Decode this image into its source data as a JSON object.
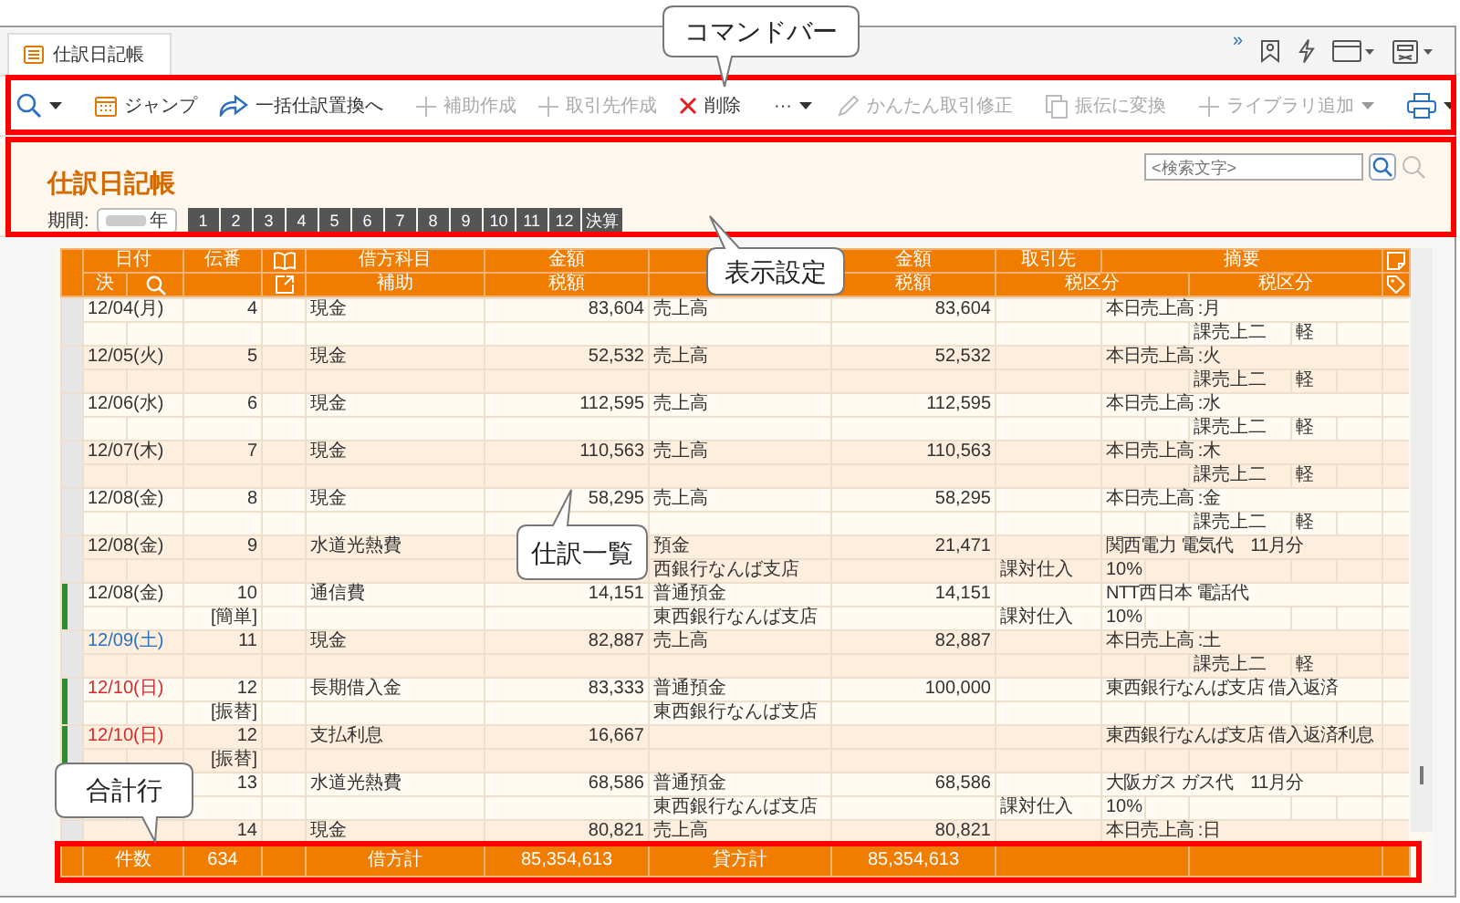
{
  "tab": {
    "title": "仕訳日記帳"
  },
  "window_bar": {
    "overflow": "»"
  },
  "toolbar": {
    "buttons": [
      {
        "label": "ジャンプ",
        "disabled": false
      },
      {
        "label": "一括仕訳置換へ",
        "disabled": false
      },
      {
        "label": "補助作成",
        "disabled": true
      },
      {
        "label": "取引先作成",
        "disabled": true
      },
      {
        "label": "削除",
        "disabled": false
      }
    ],
    "more": "···",
    "right_buttons": [
      {
        "label": "かんたん取引修正",
        "disabled": true
      },
      {
        "label": "振伝に変換",
        "disabled": true
      },
      {
        "label": "ライブラリ追加",
        "disabled": true
      }
    ]
  },
  "settings": {
    "title": "仕訳日記帳",
    "search_placeholder": "<検索文字>",
    "period_label": "期間:",
    "year_suffix": "年",
    "months": [
      {
        "label": "1",
        "selected": false
      },
      {
        "label": "2",
        "selected": false
      },
      {
        "label": "3",
        "selected": false
      },
      {
        "label": "4",
        "selected": false
      },
      {
        "label": "5",
        "selected": false
      },
      {
        "label": "6",
        "selected": false
      },
      {
        "label": "7",
        "selected": false
      },
      {
        "label": "8",
        "selected": false
      },
      {
        "label": "9",
        "selected": false
      },
      {
        "label": "10",
        "selected": false
      },
      {
        "label": "11",
        "selected": false
      },
      {
        "label": "12",
        "selected": false
      },
      {
        "label": "決算",
        "selected": false
      }
    ]
  },
  "table": {
    "header_top": [
      "日付",
      "伝番",
      "借方科目",
      "金額",
      "金額",
      "取引先",
      "摘要"
    ],
    "header_bottom": [
      "決",
      "補助",
      "税額",
      "税額",
      "税区分",
      "税区分"
    ],
    "entries": [
      {
        "date": "12/04(月)",
        "color": "#333333",
        "marked": false,
        "no": "4",
        "debit_account": "現金",
        "debit_amount": "83,604",
        "credit_account": "売上高",
        "credit_amount": "83,604",
        "summary": "本日売上高 :月",
        "credit_tax_class": "課売上二",
        "credit_tax_rate": "軽"
      },
      {
        "date": "12/05(火)",
        "color": "#333333",
        "marked": false,
        "no": "5",
        "debit_account": "現金",
        "debit_amount": "52,532",
        "credit_account": "売上高",
        "credit_amount": "52,532",
        "summary": "本日売上高 :火",
        "credit_tax_class": "課売上二",
        "credit_tax_rate": "軽"
      },
      {
        "date": "12/06(水)",
        "color": "#333333",
        "marked": false,
        "no": "6",
        "debit_account": "現金",
        "debit_amount": "112,595",
        "credit_account": "売上高",
        "credit_amount": "112,595",
        "summary": "本日売上高 :水",
        "credit_tax_class": "課売上二",
        "credit_tax_rate": "軽"
      },
      {
        "date": "12/07(木)",
        "color": "#333333",
        "marked": false,
        "no": "7",
        "debit_account": "現金",
        "debit_amount": "110,563",
        "credit_account": "売上高",
        "credit_amount": "110,563",
        "summary": "本日売上高 :木",
        "credit_tax_class": "課売上二",
        "credit_tax_rate": "軽"
      },
      {
        "date": "12/08(金)",
        "color": "#333333",
        "marked": false,
        "no": "8",
        "debit_account": "現金",
        "debit_amount": "58,295",
        "credit_account": "売上高",
        "credit_amount": "58,295",
        "summary": "本日売上高 :金",
        "credit_tax_class": "課売上二",
        "credit_tax_rate": "軽"
      },
      {
        "date": "12/08(金)",
        "color": "#333333",
        "marked": false,
        "no": "9",
        "debit_account": "水道光熱費",
        "credit_account": "預金",
        "credit_amount": "21,471",
        "summary": "関西電力 電気代　11月分",
        "credit_sub": "西銀行なんば支店",
        "debit_tax_class": "課対仕入",
        "debit_tax_rate": "10%"
      },
      {
        "date": "12/08(金)",
        "color": "#333333",
        "marked": true,
        "no": "10",
        "debit_account": "通信費",
        "debit_amount": "14,151",
        "credit_account": "普通預金",
        "credit_amount": "14,151",
        "summary": "NTT西日本 電話代",
        "entry_type": "[簡単]",
        "credit_sub": "東西銀行なんば支店",
        "debit_tax_class": "課対仕入",
        "debit_tax_rate": "10%"
      },
      {
        "date": "12/09(土)",
        "color": "#2a6fc0",
        "marked": false,
        "no": "11",
        "debit_account": "現金",
        "debit_amount": "82,887",
        "credit_account": "売上高",
        "credit_amount": "82,887",
        "summary": "本日売上高 :土",
        "credit_tax_class": "課売上二",
        "credit_tax_rate": "軽"
      },
      {
        "date": "12/10(日)",
        "color": "#d42a2a",
        "marked": true,
        "no": "12",
        "debit_account": "長期借入金",
        "debit_amount": "83,333",
        "credit_account": "普通預金",
        "credit_amount": "100,000",
        "summary": "東西銀行なんば支店 借入返済",
        "entry_type": "[振替]",
        "credit_sub": "東西銀行なんば支店"
      },
      {
        "date": "12/10(日)",
        "color": "#d42a2a",
        "marked": true,
        "no": "12",
        "debit_account": "支払利息",
        "debit_amount": "16,667",
        "summary": "東西銀行なんば支店 借入返済利息",
        "entry_type": "[振替]"
      },
      {
        "marked": false,
        "no": "13",
        "debit_account": "水道光熱費",
        "debit_amount": "68,586",
        "credit_account": "普通預金",
        "credit_amount": "68,586",
        "summary": "大阪ガス ガス代　11月分",
        "credit_sub": "東西銀行なんば支店",
        "debit_tax_class": "課対仕入",
        "debit_tax_rate": "10%"
      },
      {
        "marked": false,
        "no": "14",
        "debit_account": "現金",
        "debit_amount": "80,821",
        "credit_account": "売上高",
        "credit_amount": "80,821",
        "summary": "本日売上高 :日"
      }
    ],
    "totals": {
      "count_label": "件数",
      "count": "634",
      "debit_label": "借方計",
      "debit_total": "85,354,613",
      "credit_label": "貸方計",
      "credit_total": "85,354,613"
    }
  },
  "callouts": [
    {
      "text": "コマンドバー"
    },
    {
      "text": "表示設定"
    },
    {
      "text": "仕訳一覧"
    },
    {
      "text": "合計行"
    }
  ]
}
